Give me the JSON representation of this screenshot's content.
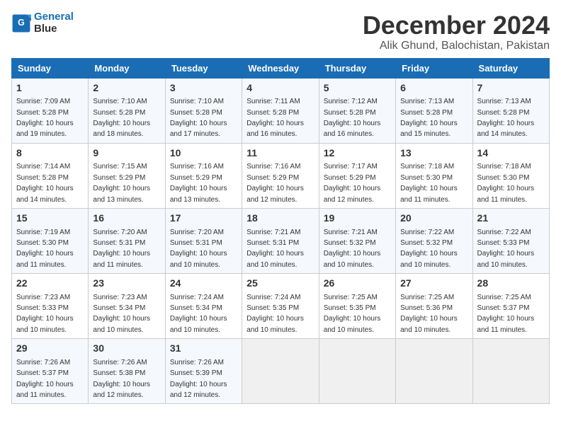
{
  "header": {
    "logo_line1": "General",
    "logo_line2": "Blue",
    "title": "December 2024",
    "subtitle": "Alik Ghund, Balochistan, Pakistan"
  },
  "weekdays": [
    "Sunday",
    "Monday",
    "Tuesday",
    "Wednesday",
    "Thursday",
    "Friday",
    "Saturday"
  ],
  "weeks": [
    [
      {
        "day": "1",
        "sunrise": "7:09 AM",
        "sunset": "5:28 PM",
        "daylight": "10 hours and 19 minutes."
      },
      {
        "day": "2",
        "sunrise": "7:10 AM",
        "sunset": "5:28 PM",
        "daylight": "10 hours and 18 minutes."
      },
      {
        "day": "3",
        "sunrise": "7:10 AM",
        "sunset": "5:28 PM",
        "daylight": "10 hours and 17 minutes."
      },
      {
        "day": "4",
        "sunrise": "7:11 AM",
        "sunset": "5:28 PM",
        "daylight": "10 hours and 16 minutes."
      },
      {
        "day": "5",
        "sunrise": "7:12 AM",
        "sunset": "5:28 PM",
        "daylight": "10 hours and 16 minutes."
      },
      {
        "day": "6",
        "sunrise": "7:13 AM",
        "sunset": "5:28 PM",
        "daylight": "10 hours and 15 minutes."
      },
      {
        "day": "7",
        "sunrise": "7:13 AM",
        "sunset": "5:28 PM",
        "daylight": "10 hours and 14 minutes."
      }
    ],
    [
      {
        "day": "8",
        "sunrise": "7:14 AM",
        "sunset": "5:28 PM",
        "daylight": "10 hours and 14 minutes."
      },
      {
        "day": "9",
        "sunrise": "7:15 AM",
        "sunset": "5:29 PM",
        "daylight": "10 hours and 13 minutes."
      },
      {
        "day": "10",
        "sunrise": "7:16 AM",
        "sunset": "5:29 PM",
        "daylight": "10 hours and 13 minutes."
      },
      {
        "day": "11",
        "sunrise": "7:16 AM",
        "sunset": "5:29 PM",
        "daylight": "10 hours and 12 minutes."
      },
      {
        "day": "12",
        "sunrise": "7:17 AM",
        "sunset": "5:29 PM",
        "daylight": "10 hours and 12 minutes."
      },
      {
        "day": "13",
        "sunrise": "7:18 AM",
        "sunset": "5:30 PM",
        "daylight": "10 hours and 11 minutes."
      },
      {
        "day": "14",
        "sunrise": "7:18 AM",
        "sunset": "5:30 PM",
        "daylight": "10 hours and 11 minutes."
      }
    ],
    [
      {
        "day": "15",
        "sunrise": "7:19 AM",
        "sunset": "5:30 PM",
        "daylight": "10 hours and 11 minutes."
      },
      {
        "day": "16",
        "sunrise": "7:20 AM",
        "sunset": "5:31 PM",
        "daylight": "10 hours and 11 minutes."
      },
      {
        "day": "17",
        "sunrise": "7:20 AM",
        "sunset": "5:31 PM",
        "daylight": "10 hours and 10 minutes."
      },
      {
        "day": "18",
        "sunrise": "7:21 AM",
        "sunset": "5:31 PM",
        "daylight": "10 hours and 10 minutes."
      },
      {
        "day": "19",
        "sunrise": "7:21 AM",
        "sunset": "5:32 PM",
        "daylight": "10 hours and 10 minutes."
      },
      {
        "day": "20",
        "sunrise": "7:22 AM",
        "sunset": "5:32 PM",
        "daylight": "10 hours and 10 minutes."
      },
      {
        "day": "21",
        "sunrise": "7:22 AM",
        "sunset": "5:33 PM",
        "daylight": "10 hours and 10 minutes."
      }
    ],
    [
      {
        "day": "22",
        "sunrise": "7:23 AM",
        "sunset": "5:33 PM",
        "daylight": "10 hours and 10 minutes."
      },
      {
        "day": "23",
        "sunrise": "7:23 AM",
        "sunset": "5:34 PM",
        "daylight": "10 hours and 10 minutes."
      },
      {
        "day": "24",
        "sunrise": "7:24 AM",
        "sunset": "5:34 PM",
        "daylight": "10 hours and 10 minutes."
      },
      {
        "day": "25",
        "sunrise": "7:24 AM",
        "sunset": "5:35 PM",
        "daylight": "10 hours and 10 minutes."
      },
      {
        "day": "26",
        "sunrise": "7:25 AM",
        "sunset": "5:35 PM",
        "daylight": "10 hours and 10 minutes."
      },
      {
        "day": "27",
        "sunrise": "7:25 AM",
        "sunset": "5:36 PM",
        "daylight": "10 hours and 10 minutes."
      },
      {
        "day": "28",
        "sunrise": "7:25 AM",
        "sunset": "5:37 PM",
        "daylight": "10 hours and 11 minutes."
      }
    ],
    [
      {
        "day": "29",
        "sunrise": "7:26 AM",
        "sunset": "5:37 PM",
        "daylight": "10 hours and 11 minutes."
      },
      {
        "day": "30",
        "sunrise": "7:26 AM",
        "sunset": "5:38 PM",
        "daylight": "10 hours and 12 minutes."
      },
      {
        "day": "31",
        "sunrise": "7:26 AM",
        "sunset": "5:39 PM",
        "daylight": "10 hours and 12 minutes."
      },
      null,
      null,
      null,
      null
    ]
  ],
  "labels": {
    "sunrise_prefix": "Sunrise: ",
    "sunset_prefix": "Sunset: ",
    "daylight_prefix": "Daylight: "
  }
}
